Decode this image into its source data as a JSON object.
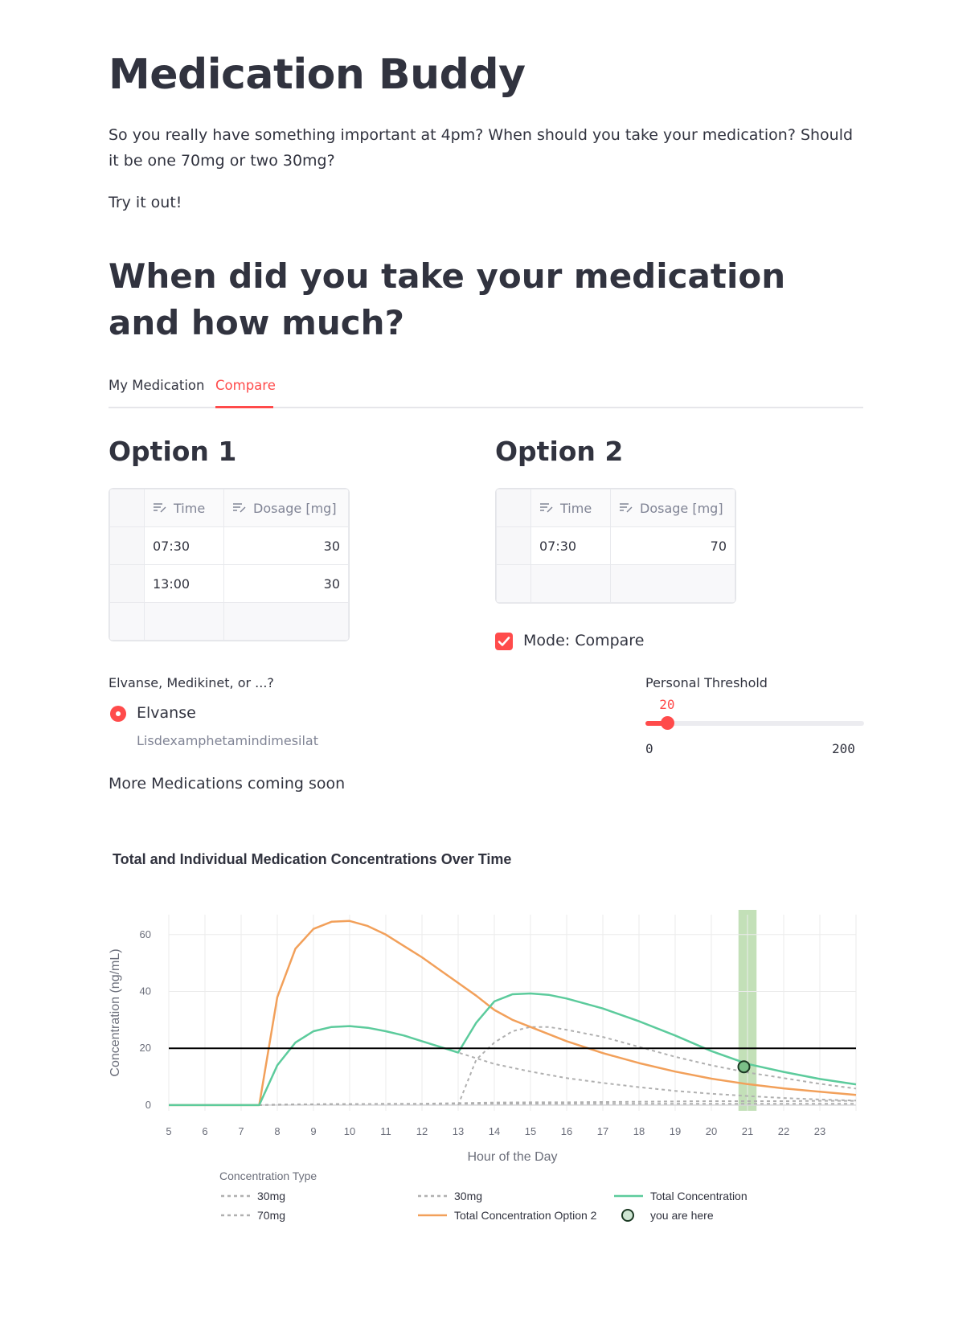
{
  "page": {
    "title": "Medication Buddy",
    "intro": "So you really have something important at 4pm? When should you take your medication? Should it be one 70mg or two 30mg?",
    "try_it": "Try it out!",
    "section_title": "When did you take your medication and how much?"
  },
  "tabs": [
    {
      "label": "My Medication",
      "active": false
    },
    {
      "label": "Compare",
      "active": true
    }
  ],
  "option1": {
    "title": "Option 1",
    "columns": [
      "Time",
      "Dosage [mg]"
    ],
    "rows": [
      [
        "07:30",
        "30"
      ],
      [
        "13:00",
        "30"
      ]
    ]
  },
  "option2": {
    "title": "Option 2",
    "columns": [
      "Time",
      "Dosage [mg]"
    ],
    "rows": [
      [
        "07:30",
        "70"
      ]
    ]
  },
  "mode_compare": {
    "label": "Mode: Compare",
    "checked": true
  },
  "medication": {
    "question": "Elvanse, Medikinet, or ...?",
    "selected": "Elvanse",
    "caption": "Lisdexamphetamindimesilat",
    "more": "More Medications coming soon"
  },
  "threshold": {
    "label": "Personal Threshold",
    "value": "20",
    "min": "0",
    "max": "200",
    "fraction": 0.1
  },
  "colors": {
    "accent": "#ff4b4b",
    "text": "#31333f",
    "total": "#5ccb9c",
    "option2": "#f2a05a",
    "individual": "#b0b0b0",
    "band": "#a9d39a"
  },
  "chart_data": {
    "type": "line",
    "title": "Total and Individual Medication Concentrations Over Time",
    "xlabel": "Hour of the Day",
    "ylabel": "Concentration (ng/mL)",
    "xlim": [
      5,
      24
    ],
    "ylim": [
      -2,
      67
    ],
    "xticks": [
      "5",
      "6",
      "7",
      "8",
      "9",
      "10",
      "11",
      "12",
      "13",
      "14",
      "15",
      "16",
      "17",
      "18",
      "19",
      "20",
      "21",
      "22",
      "23"
    ],
    "yticks": [
      "0",
      "20",
      "40",
      "60"
    ],
    "threshold": 20,
    "current_time_band": [
      20.75,
      21.25
    ],
    "you_are_here": {
      "x": 20.9,
      "y": 13.5
    },
    "grid": true,
    "legend_title": "Concentration Type",
    "series": [
      {
        "name": "30mg",
        "style": "dotted",
        "x": [
          5,
          7.5,
          8,
          8.5,
          9,
          9.5,
          10,
          10.5,
          11,
          11.5,
          12,
          12.5,
          13,
          13.5,
          14,
          15,
          16,
          17,
          18,
          19,
          20,
          21,
          22,
          23,
          24
        ],
        "y": [
          0,
          0,
          0.1,
          0.2,
          0.3,
          0.3,
          0.3,
          0.4,
          0.4,
          0.4,
          0.4,
          0.4,
          0.5,
          0.5,
          0.5,
          0.5,
          0.5,
          0.5,
          0.5,
          0.5,
          0.5,
          0.5,
          0.5,
          0.5,
          0.5
        ]
      },
      {
        "name": "70mg",
        "style": "dotted",
        "x": [
          5,
          7.5,
          8,
          8.5,
          9,
          9.5,
          10,
          10.5,
          11,
          11.5,
          12,
          12.5,
          13,
          13.5,
          14,
          15,
          16,
          17,
          18,
          19,
          20,
          21,
          22,
          23,
          24
        ],
        "y": [
          0,
          0,
          0.2,
          0.3,
          0.3,
          0.4,
          0.4,
          0.4,
          0.5,
          0.5,
          0.5,
          0.6,
          0.7,
          0.8,
          0.9,
          1,
          1,
          1.1,
          1.2,
          1.3,
          1.4,
          1.4,
          1.4,
          1.5,
          1.5
        ]
      },
      {
        "name": "30mg",
        "style": "dotted",
        "x": [
          7.5,
          8,
          8.5,
          9,
          9.5,
          10,
          10.5,
          11,
          11.5,
          12,
          12.5,
          13,
          13.5,
          14,
          15,
          16,
          17,
          18,
          19,
          20,
          21,
          22,
          23,
          24
        ],
        "y": [
          0,
          14,
          22,
          26,
          27.5,
          27.8,
          27.2,
          26,
          24.5,
          22.5,
          20.5,
          18.5,
          16.5,
          14.5,
          11.8,
          9.5,
          7.8,
          6.3,
          5,
          4,
          3.2,
          2.5,
          2,
          1.6
        ]
      },
      {
        "name": "30mg",
        "style": "dotted",
        "x": [
          13,
          13.5,
          14,
          14.5,
          15,
          15.5,
          16,
          17,
          18,
          19,
          20,
          21,
          22,
          23,
          24
        ],
        "y": [
          0,
          16,
          22,
          26,
          27.5,
          27.5,
          26.5,
          24,
          20.5,
          17,
          14,
          11.5,
          9.5,
          7.5,
          5.8
        ]
      },
      {
        "name": "Total Concentration Option 2",
        "style": "solid",
        "x": [
          5,
          7.5,
          8,
          8.5,
          9,
          9.5,
          10,
          10.5,
          11,
          11.5,
          12,
          12.5,
          13,
          13.5,
          14,
          14.5,
          15,
          16,
          17,
          18,
          19,
          20,
          21,
          22,
          23,
          24
        ],
        "y": [
          0,
          0,
          38,
          55,
          62,
          64.5,
          64.8,
          63,
          60,
          56,
          52,
          47.5,
          43,
          38.5,
          33.5,
          30,
          27.5,
          22.5,
          18.3,
          14.8,
          11.8,
          9.3,
          7.4,
          5.9,
          4.7,
          3.6
        ]
      },
      {
        "name": "Total Concentration",
        "style": "solid",
        "x": [
          5,
          7.5,
          8,
          8.5,
          9,
          9.5,
          10,
          10.5,
          11,
          11.5,
          12,
          12.5,
          13,
          13.5,
          14,
          14.5,
          15,
          15.5,
          16,
          17,
          18,
          19,
          20,
          21,
          22,
          23,
          24
        ],
        "y": [
          0,
          0,
          14,
          22,
          26,
          27.5,
          27.8,
          27.2,
          26,
          24.5,
          22.5,
          20.5,
          18.5,
          29,
          36.5,
          39,
          39.3,
          38.8,
          37.5,
          34,
          29.5,
          24.5,
          19,
          14.5,
          11.7,
          9.2,
          7.3
        ]
      }
    ],
    "legend": [
      {
        "name": "30mg",
        "style": "dotted"
      },
      {
        "name": "70mg",
        "style": "dotted"
      },
      {
        "name": "30mg",
        "style": "dotted"
      },
      {
        "name": "Total Concentration Option 2",
        "style": "solid-orange"
      },
      {
        "name": "Total Concentration",
        "style": "solid-green"
      },
      {
        "name": "you are here",
        "style": "marker"
      }
    ]
  }
}
